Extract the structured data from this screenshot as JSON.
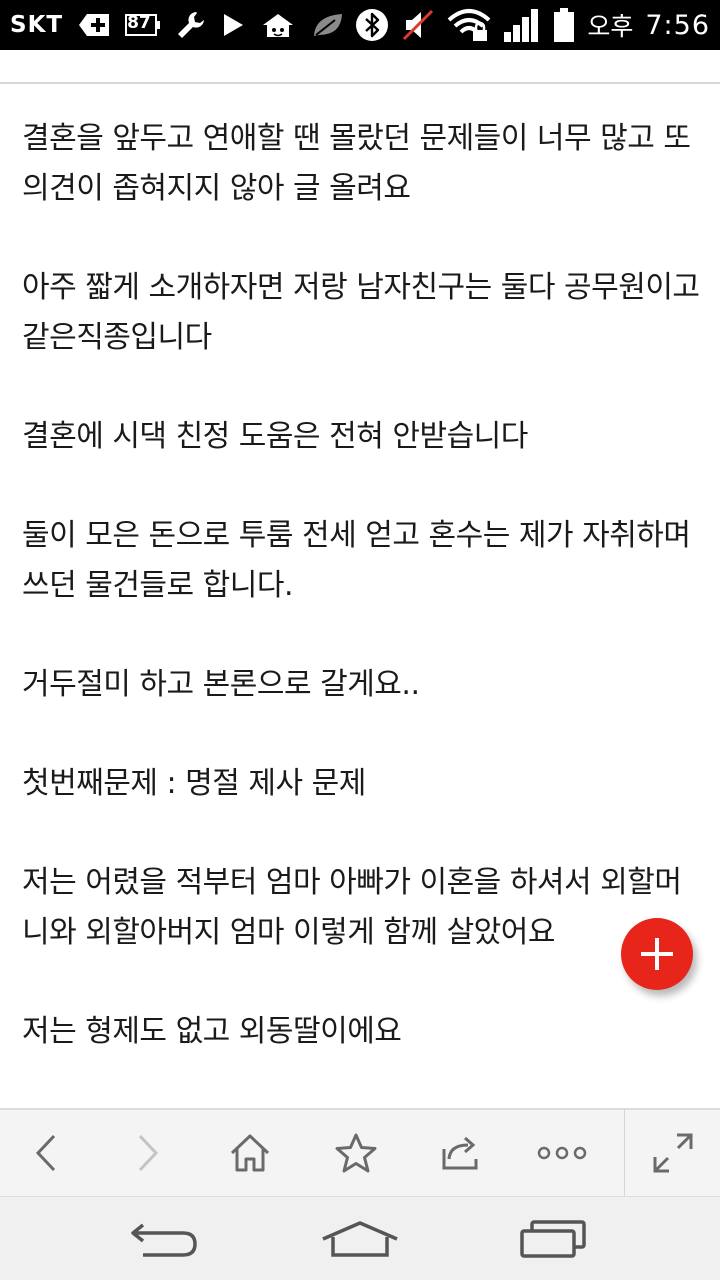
{
  "status_bar": {
    "carrier": "SKT",
    "battery_level": "87",
    "ampm": "오후",
    "time": "7:56",
    "icons": [
      "plus-box-icon",
      "battery-87-icon",
      "wrench-icon",
      "play-icon",
      "home-app-icon",
      "leaf-icon",
      "bluetooth-icon",
      "mute-icon",
      "wifi-lock-icon",
      "signal-icon",
      "battery-icon"
    ]
  },
  "article": {
    "paragraphs": [
      "결혼을 앞두고 연애할 땐 몰랐던 문제들이 너무 많고 또 의견이 좁혀지지 않아 글 올려요",
      "아주 짧게 소개하자면 저랑 남자친구는 둘다 공무원이고 같은직종입니다",
      "결혼에 시댁 친정 도움은 전혀 안받습니다",
      "둘이 모은 돈으로 투룸 전세 얻고 혼수는 제가 자취하며 쓰던 물건들로 합니다.",
      "거두절미 하고 본론으로 갈게요..",
      "첫번째문제 : 명절 제사 문제",
      "저는 어렸을 적부터 엄마 아빠가 이혼을 하셔서 외할머니와 외할아버지 엄마 이렇게 함께 살았어요",
      "저는 형제도 없고 외동딸이에요"
    ]
  },
  "fab": {
    "icon": "plus-icon",
    "color": "#e8251b"
  },
  "browser_toolbar": {
    "buttons": [
      "back-icon",
      "forward-icon",
      "home-icon",
      "bookmark-star-icon",
      "share-icon",
      "more-icon",
      "fullscreen-icon"
    ]
  },
  "nav_bar": {
    "buttons": [
      "nav-back-icon",
      "nav-home-icon",
      "nav-recents-icon"
    ]
  }
}
